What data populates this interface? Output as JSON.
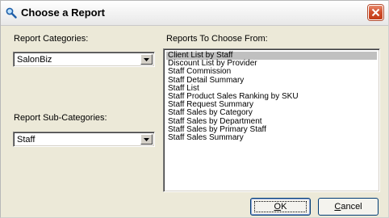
{
  "window": {
    "title": "Choose a Report",
    "title_icon": "magnifier-icon",
    "close_icon": "close-icon"
  },
  "left": {
    "categories_label": "Report Categories:",
    "category_value": "SalonBiz",
    "subcategories_label": "Report Sub-Categories:",
    "subcategory_value": "Staff"
  },
  "right": {
    "reports_label": "Reports To Choose From:",
    "selected_index": 0,
    "reports": [
      "Client List by Staff",
      "Discount List by Provider",
      "Staff Commission",
      "Staff Detail Summary",
      "Staff List",
      "Staff Product Sales Ranking by SKU",
      "Staff Request Summary",
      "Staff Sales by Category",
      "Staff Sales by Department",
      "Staff Sales by Primary Staff",
      "Staff Sales Summary"
    ]
  },
  "buttons": {
    "ok_mnemonic": "O",
    "ok_rest": "K",
    "cancel_mnemonic": "C",
    "cancel_rest": "ancel"
  },
  "colors": {
    "dialog_bg": "#ece9d8",
    "selection": "#c0c0c0",
    "close_button": "#c23b16"
  }
}
